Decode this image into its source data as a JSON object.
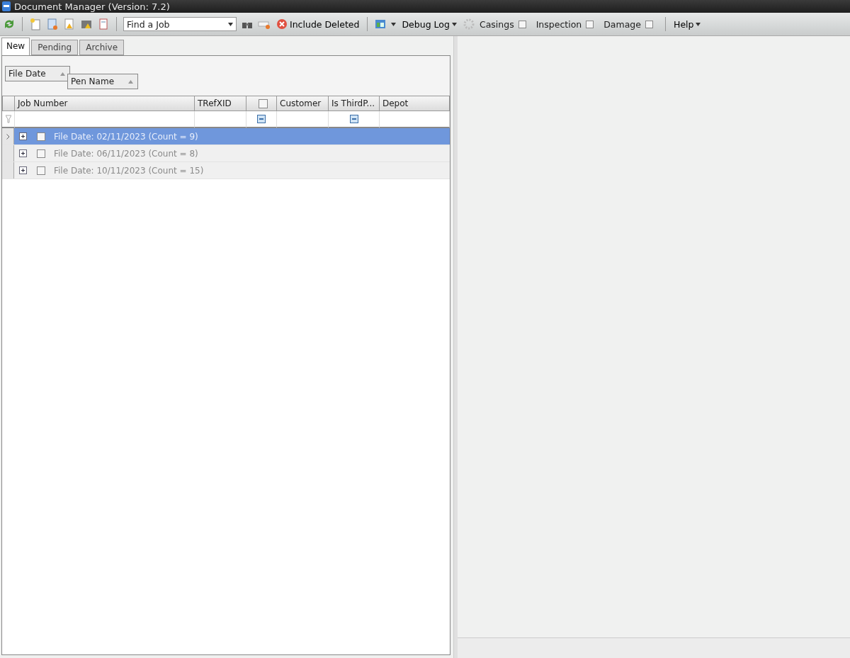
{
  "window": {
    "title": "Document Manager (Version: 7.2)"
  },
  "toolbar": {
    "find_job": {
      "value": "Find a Job"
    },
    "include_deleted": "Include Deleted",
    "debug_log": "Debug Log",
    "filters": [
      {
        "label": "Casings",
        "checked": false
      },
      {
        "label": "Inspection",
        "checked": false
      },
      {
        "label": "Damage",
        "checked": false
      }
    ],
    "help": "Help"
  },
  "tabs": [
    {
      "label": "New",
      "selected": true
    },
    {
      "label": "Pending",
      "selected": false
    },
    {
      "label": "Archive",
      "selected": false
    }
  ],
  "group_by": [
    "File Date",
    "Pen Name"
  ],
  "table": {
    "columns": [
      {
        "kind": "text",
        "label": "Job Number"
      },
      {
        "kind": "text",
        "label": "TRefXID"
      },
      {
        "kind": "check",
        "checked": false
      },
      {
        "kind": "text",
        "label": "Customer"
      },
      {
        "kind": "flag",
        "label": "Is ThirdP..."
      },
      {
        "kind": "text",
        "label": "Depot"
      }
    ],
    "groups": [
      {
        "label": "File Date: 02/11/2023 (Count = 9)",
        "selected": true,
        "expanded": false,
        "checked": false
      },
      {
        "label": "File Date: 06/11/2023 (Count = 8)",
        "selected": false,
        "expanded": false,
        "checked": false
      },
      {
        "label": "File Date: 10/11/2023 (Count = 15)",
        "selected": false,
        "expanded": false,
        "checked": false
      }
    ]
  }
}
